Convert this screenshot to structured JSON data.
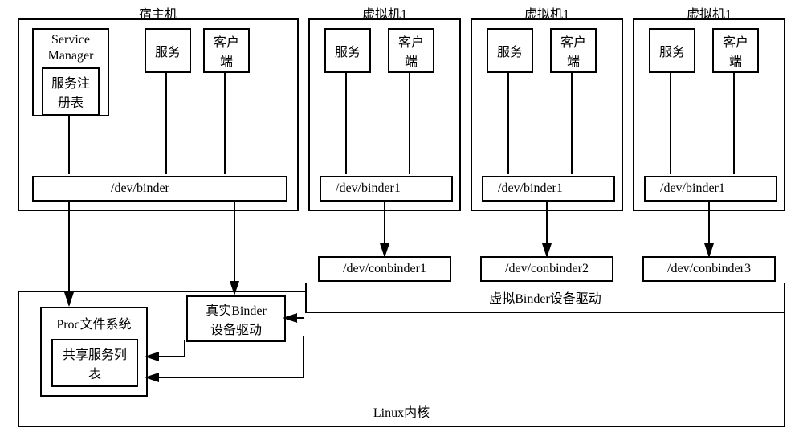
{
  "host": {
    "title": "宿主机",
    "service_manager": "Service\nManager",
    "registry": "服务注\n册表",
    "service": "服务",
    "client": "客户\n端",
    "binder": "/dev/binder"
  },
  "vm1": {
    "title": "虚拟机1",
    "service": "服务",
    "client": "客户\n端",
    "binder": "/dev/binder1",
    "conbinder": "/dev/conbinder1"
  },
  "vm2": {
    "title": "虚拟机1",
    "service": "服务",
    "client": "客户\n端",
    "binder": "/dev/binder1",
    "conbinder": "/dev/conbinder2"
  },
  "vm3": {
    "title": "虚拟机1",
    "service": "服务",
    "client": "客户\n端",
    "binder": "/dev/binder1",
    "conbinder": "/dev/conbinder3"
  },
  "kernel": {
    "title": "Linux内核",
    "proc": "Proc文件系统",
    "shared_list": "共享服务列\n表",
    "real_driver": "真实Binder\n设备驱动",
    "virtual_driver": "虚拟Binder设备驱动"
  }
}
